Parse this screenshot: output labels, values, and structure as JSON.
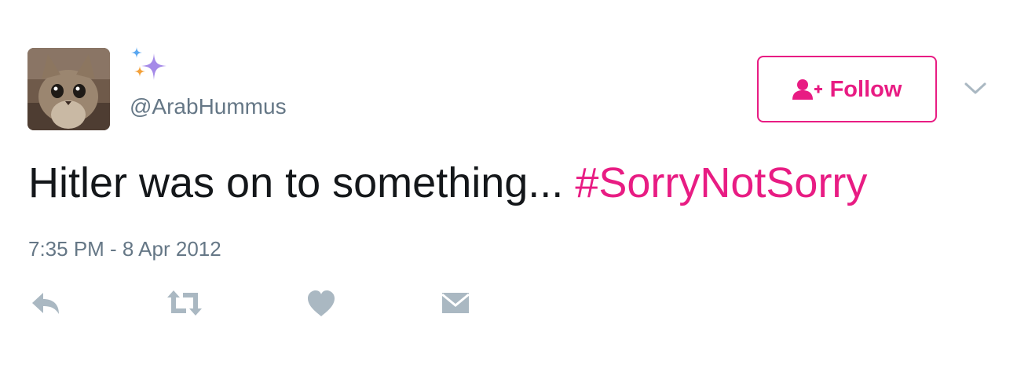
{
  "user": {
    "handle": "@ArabHummus",
    "avatar_icon": "cat-avatar-image",
    "badge_icon": "sparkles-icon"
  },
  "follow_button": {
    "label": "Follow",
    "icon": "add-user-icon"
  },
  "menu": {
    "icon": "chevron-down-icon"
  },
  "tweet": {
    "text": "Hitler was on to something... ",
    "hashtag": "#SorryNotSorry",
    "timestamp": "7:35 PM - 8 Apr 2012"
  },
  "actions": [
    {
      "icon": "reply-icon"
    },
    {
      "icon": "retweet-icon"
    },
    {
      "icon": "like-icon"
    },
    {
      "icon": "direct-message-icon"
    }
  ],
  "colors": {
    "accent": "#e81c83",
    "text": "#14171a",
    "muted": "#657786",
    "icon": "#aab8c2"
  }
}
